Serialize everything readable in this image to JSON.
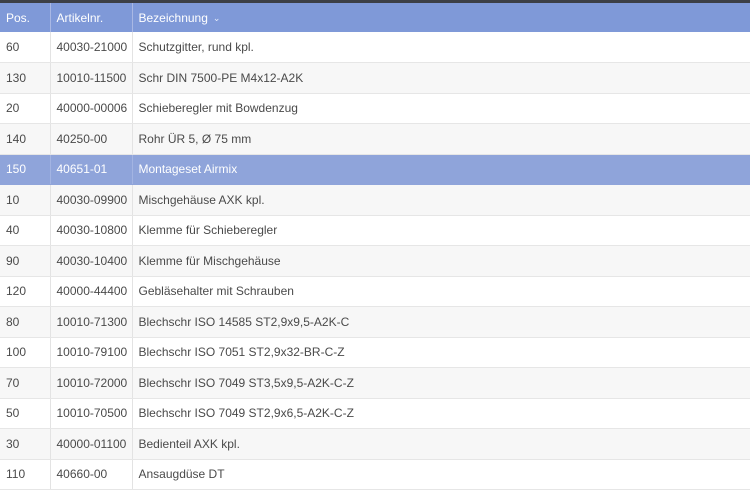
{
  "table": {
    "columns": [
      {
        "key": "pos",
        "label": "Pos."
      },
      {
        "key": "artikelnr",
        "label": "Artikelnr."
      },
      {
        "key": "bezeichnung",
        "label": "Bezeichnung",
        "sorted": true
      }
    ],
    "sort_indicator": "⌄",
    "selected_row": 4,
    "rows": [
      {
        "pos": "60",
        "artikelnr": "40030-21000",
        "bezeichnung": "Schutzgitter, rund kpl."
      },
      {
        "pos": "130",
        "artikelnr": "10010-11500",
        "bezeichnung": "Schr DIN 7500-PE M4x12-A2K"
      },
      {
        "pos": "20",
        "artikelnr": "40000-00006",
        "bezeichnung": "Schieberegler mit Bowdenzug"
      },
      {
        "pos": "140",
        "artikelnr": "40250-00",
        "bezeichnung": "Rohr ÜR 5, Ø 75 mm"
      },
      {
        "pos": "150",
        "artikelnr": "40651-01",
        "bezeichnung": "Montageset Airmix"
      },
      {
        "pos": "10",
        "artikelnr": "40030-09900",
        "bezeichnung": "Mischgehäuse AXK kpl."
      },
      {
        "pos": "40",
        "artikelnr": "40030-10800",
        "bezeichnung": "Klemme für Schieberegler"
      },
      {
        "pos": "90",
        "artikelnr": "40030-10400",
        "bezeichnung": "Klemme für Mischgehäuse"
      },
      {
        "pos": "120",
        "artikelnr": "40000-44400",
        "bezeichnung": "Gebläsehalter mit Schrauben"
      },
      {
        "pos": "80",
        "artikelnr": "10010-71300",
        "bezeichnung": "Blechschr ISO 14585 ST2,9x9,5-A2K-C"
      },
      {
        "pos": "100",
        "artikelnr": "10010-79100",
        "bezeichnung": "Blechschr ISO 7051 ST2,9x32-BR-C-Z"
      },
      {
        "pos": "70",
        "artikelnr": "10010-72000",
        "bezeichnung": "Blechschr ISO 7049 ST3,5x9,5-A2K-C-Z"
      },
      {
        "pos": "50",
        "artikelnr": "10010-70500",
        "bezeichnung": "Blechschr ISO 7049 ST2,9x6,5-A2K-C-Z"
      },
      {
        "pos": "30",
        "artikelnr": "40000-01100",
        "bezeichnung": "Bedienteil AXK kpl."
      },
      {
        "pos": "110",
        "artikelnr": "40660-00",
        "bezeichnung": "Ansaugdüse DT"
      }
    ]
  },
  "colors": {
    "header_bg": "#7f99d8",
    "selected_row_bg": "#8fa4da",
    "stripe_bg": "#f7f7f7",
    "text": "#4a4a4a"
  }
}
